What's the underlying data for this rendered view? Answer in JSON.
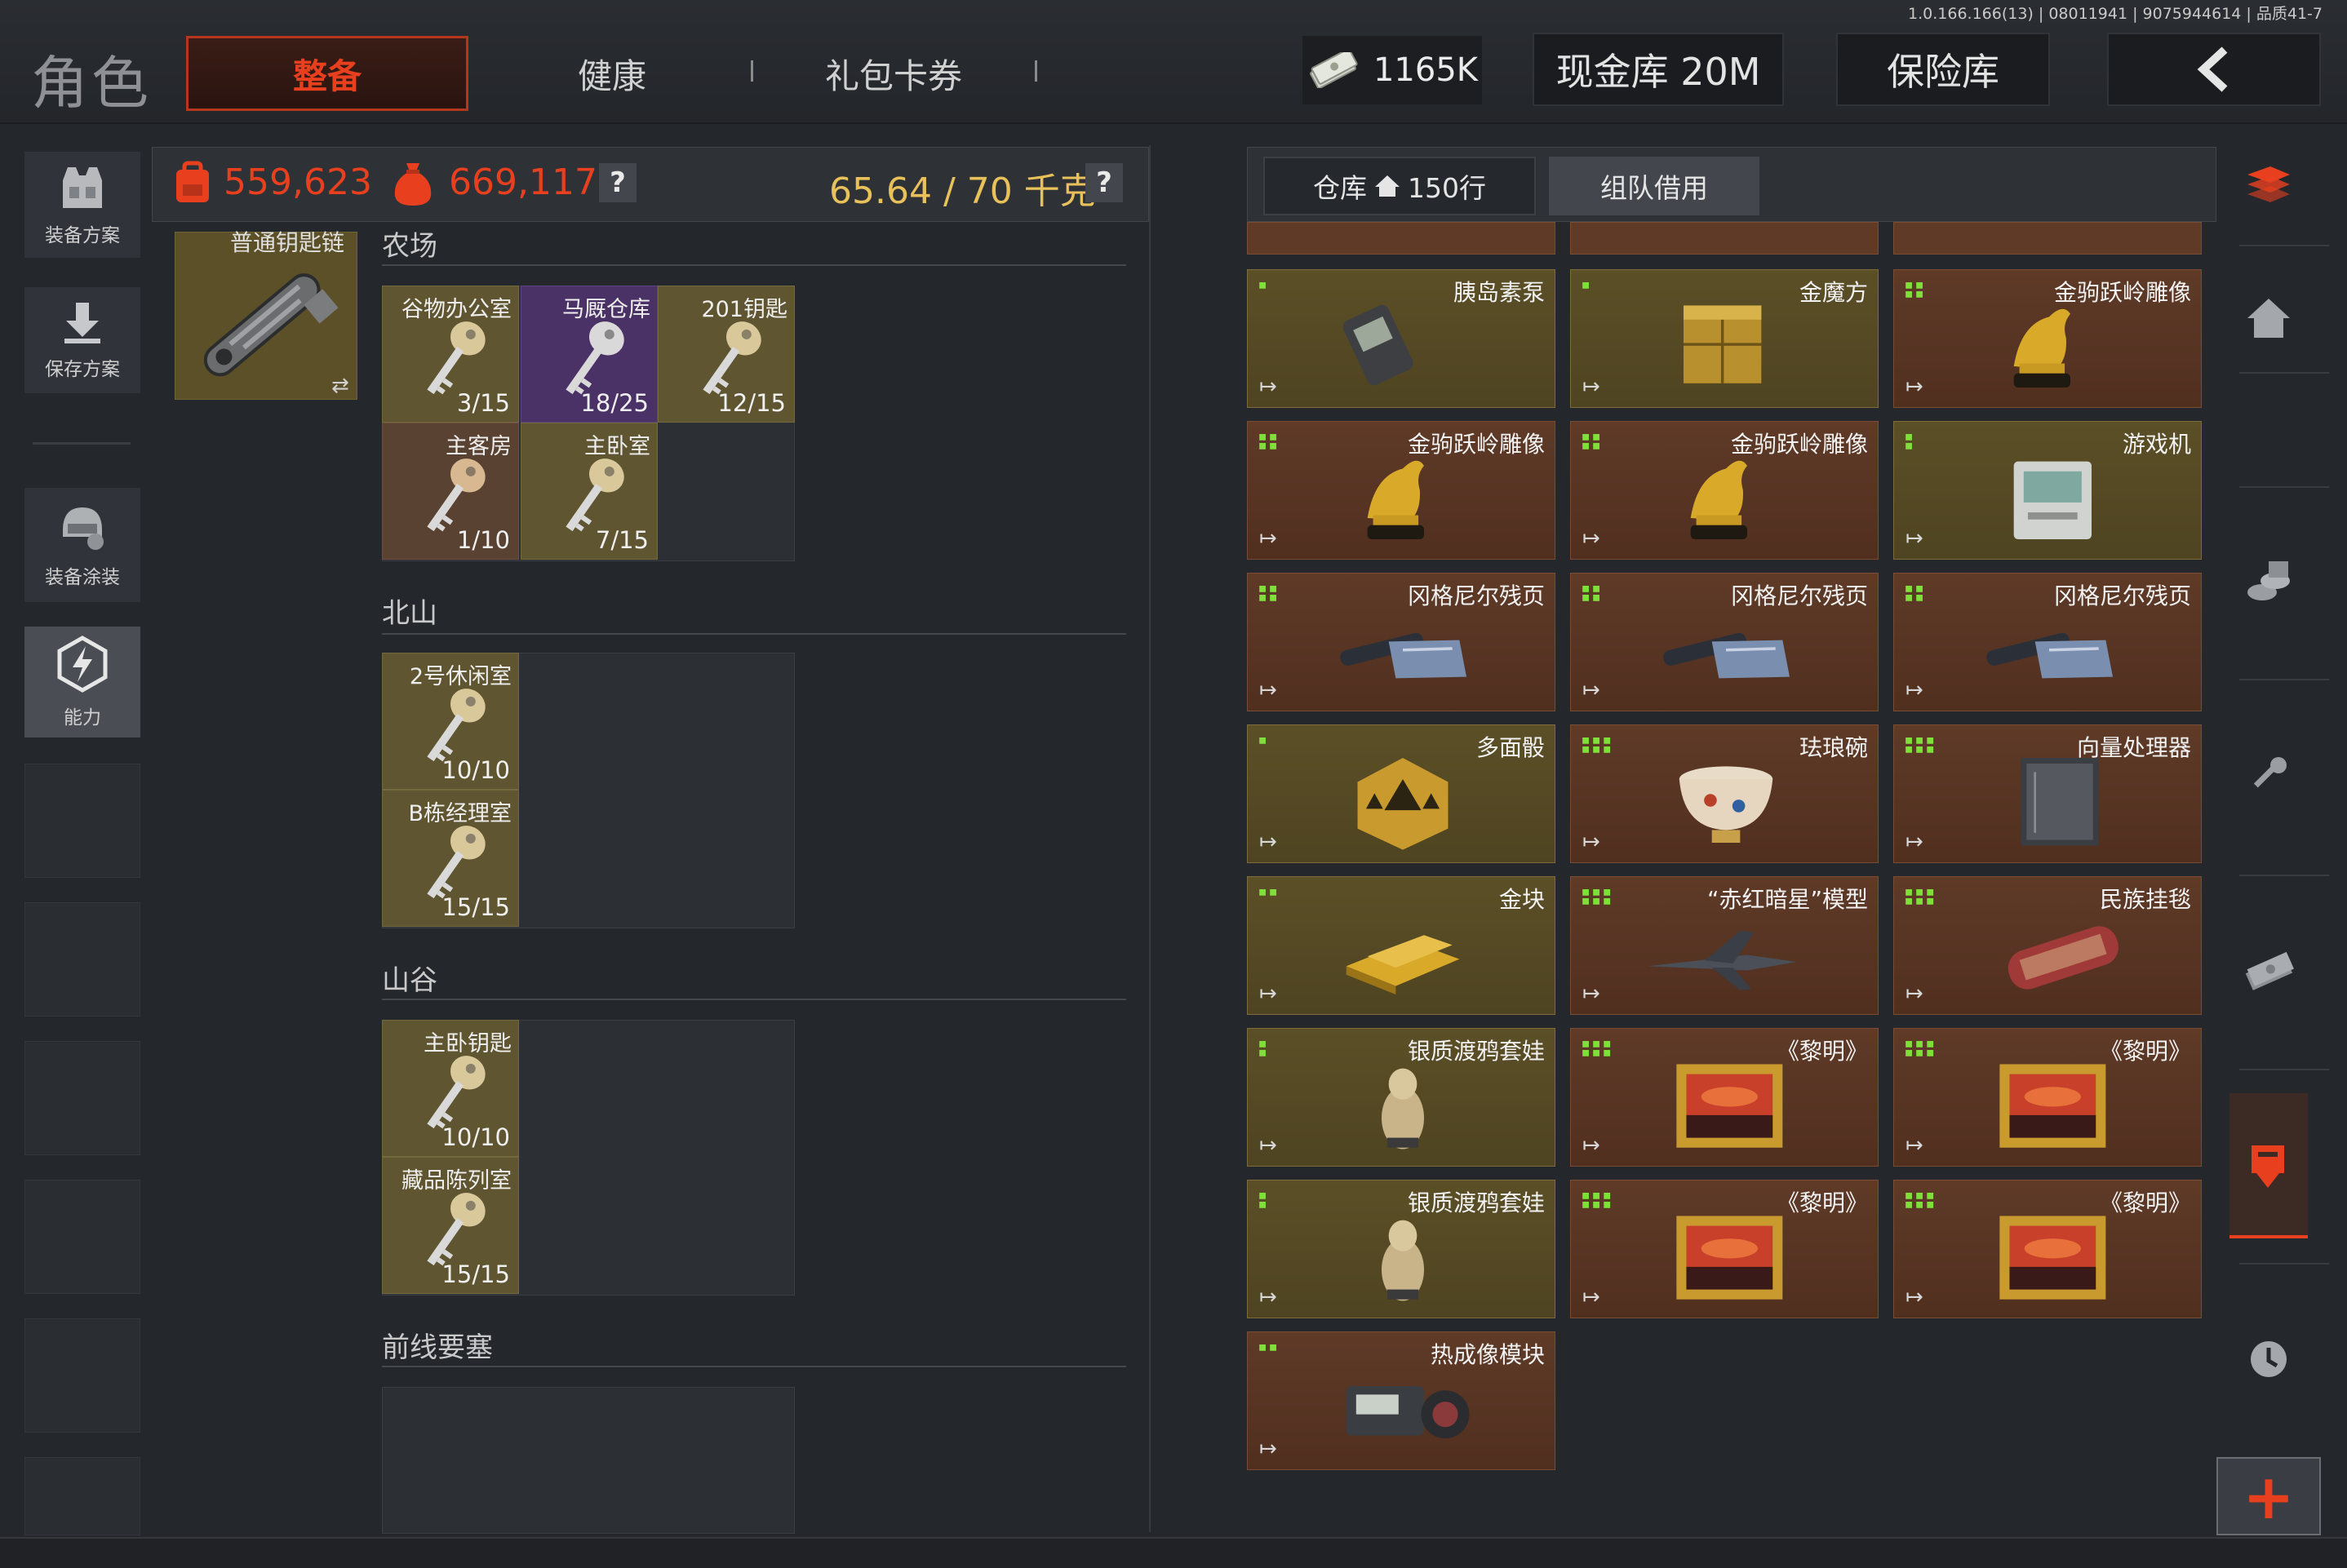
{
  "version": "1.0.166.166(13) | 08011941 | 9075944614 | 品质41-7",
  "header": {
    "title": "角色",
    "tabs": [
      {
        "label": "整备",
        "active": true
      },
      {
        "label": "健康",
        "active": false
      },
      {
        "label": "礼包卡券",
        "active": false
      }
    ],
    "money": "1165K",
    "cash_vault": "现金库 20M",
    "safe_box": "保险库"
  },
  "sidebar": {
    "items": [
      {
        "label": "装备方案",
        "icon": "vest-icon"
      },
      {
        "label": "保存方案",
        "icon": "download-icon"
      },
      {
        "label": "装备涂装",
        "icon": "helmet-paint-icon"
      },
      {
        "label": "能力",
        "icon": "ability-icon",
        "active": true
      }
    ]
  },
  "stats": {
    "backpack_value": "559,623",
    "total_value": "669,117",
    "weight": "65.64 / 70 千克",
    "help": "?"
  },
  "keychain": {
    "label": "普通钥匙链",
    "swap": "⇄"
  },
  "sections": [
    {
      "title": "农场",
      "keys": [
        {
          "name": "谷物办公室",
          "count": "3/15",
          "color": "olive"
        },
        {
          "name": "马厩仓库",
          "count": "18/25",
          "color": "purple"
        },
        {
          "name": "201钥匙",
          "count": "12/15",
          "color": "olive"
        },
        {
          "name": "主客房",
          "count": "1/10",
          "color": "brown"
        },
        {
          "name": "主卧室",
          "count": "7/15",
          "color": "olive"
        }
      ]
    },
    {
      "title": "北山",
      "keys": [
        {
          "name": "2号休闲室",
          "count": "10/10",
          "color": "olive"
        },
        {
          "name": "B栋经理室",
          "count": "15/15",
          "color": "olive"
        }
      ]
    },
    {
      "title": "山谷",
      "keys": [
        {
          "name": "主卧钥匙",
          "count": "10/10",
          "color": "olive"
        },
        {
          "name": "藏品陈列室",
          "count": "15/15",
          "color": "olive"
        }
      ]
    },
    {
      "title": "前线要塞",
      "keys": []
    }
  ],
  "warehouse": {
    "tab_label": "仓库",
    "rows_label": "150行",
    "team_tab": "组队借用",
    "exit_glyph": "↦",
    "items": [
      {
        "name": "胰岛素泵",
        "color": "gold",
        "size": "▪",
        "art": "pump"
      },
      {
        "name": "金魔方",
        "color": "gold",
        "size": "▪",
        "art": "cube"
      },
      {
        "name": "金驹跃岭雕像",
        "color": "red",
        "size": "▪▪\n▪▪",
        "art": "horse"
      },
      {
        "name": "金驹跃岭雕像",
        "color": "red",
        "size": "▪▪\n▪▪",
        "art": "horse"
      },
      {
        "name": "金驹跃岭雕像",
        "color": "red",
        "size": "▪▪\n▪▪",
        "art": "horse"
      },
      {
        "name": "游戏机",
        "color": "gold",
        "size": "▪\n▪",
        "art": "console"
      },
      {
        "name": "冈格尼尔残页",
        "color": "red",
        "size": "▪▪\n▪▪",
        "art": "scroll"
      },
      {
        "name": "冈格尼尔残页",
        "color": "red",
        "size": "▪▪\n▪▪",
        "art": "scroll"
      },
      {
        "name": "冈格尼尔残页",
        "color": "red",
        "size": "▪▪\n▪▪",
        "art": "scroll"
      },
      {
        "name": "多面骰",
        "color": "gold",
        "size": "▪",
        "art": "dice"
      },
      {
        "name": "珐琅碗",
        "color": "red",
        "size": "▪▪▪\n▪▪▪",
        "art": "bowl"
      },
      {
        "name": "向量处理器",
        "color": "red",
        "size": "▪▪▪\n▪▪▪",
        "art": "processor"
      },
      {
        "name": "金块",
        "color": "gold",
        "size": "▪▪",
        "art": "goldbar"
      },
      {
        "name": "“赤红暗星”模型",
        "color": "red",
        "size": "▪▪▪\n▪▪▪",
        "art": "jet"
      },
      {
        "name": "民族挂毯",
        "color": "red",
        "size": "▪▪▪\n▪▪▪",
        "art": "rug"
      },
      {
        "name": "银质渡鸦套娃",
        "color": "gold",
        "size": "▪\n▪",
        "art": "doll"
      },
      {
        "name": "《黎明》",
        "color": "red",
        "size": "▪▪▪\n▪▪▪",
        "art": "painting"
      },
      {
        "name": "《黎明》",
        "color": "red",
        "size": "▪▪▪\n▪▪▪",
        "art": "painting"
      },
      {
        "name": "银质渡鸦套娃",
        "color": "gold",
        "size": "▪\n▪",
        "art": "doll"
      },
      {
        "name": "《黎明》",
        "color": "red",
        "size": "▪▪▪\n▪▪▪",
        "art": "painting"
      },
      {
        "name": "《黎明》",
        "color": "red",
        "size": "▪▪▪\n▪▪▪",
        "art": "painting"
      },
      {
        "name": "热成像模块",
        "color": "red",
        "size": "▪▪",
        "art": "thermal"
      }
    ]
  },
  "right_sidebar": {
    "icons": [
      "stack-icon",
      "home-icon",
      "coins-icon",
      "key-icon",
      "cash-icon",
      "transfer-icon",
      "clock-icon"
    ],
    "plus": "+"
  },
  "colors": {
    "accent": "#e8401f",
    "weight": "#e8c15a",
    "gold_item": "#5b4f27",
    "red_item": "#5e3a27"
  }
}
